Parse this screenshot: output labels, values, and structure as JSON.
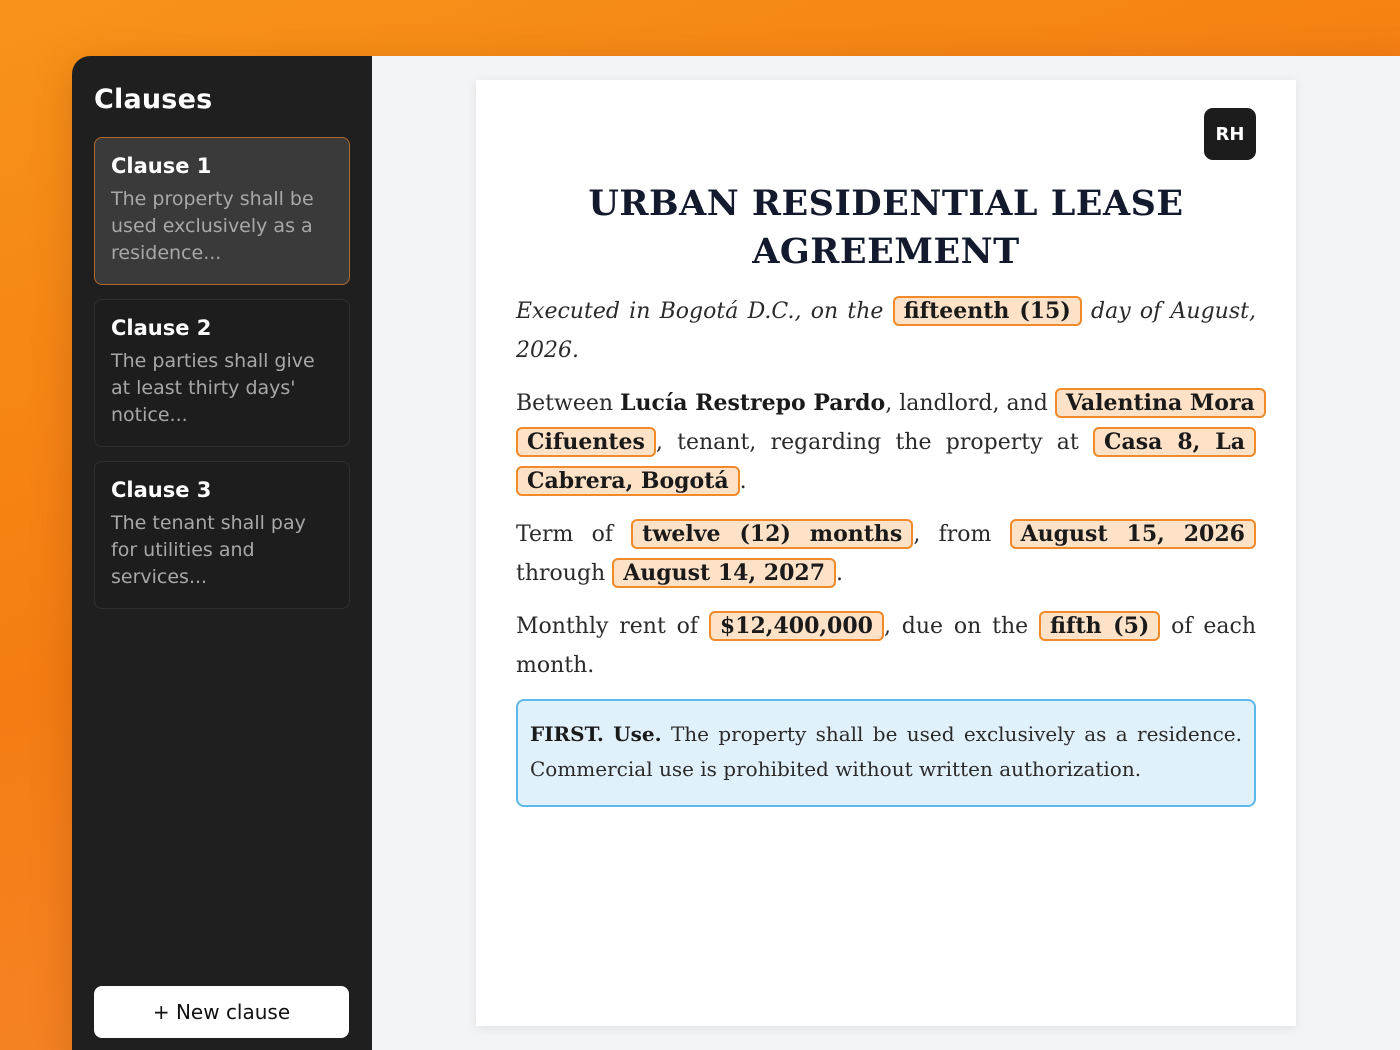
{
  "sidebar": {
    "title": "Clauses",
    "items": [
      {
        "label": "Clause 1",
        "preview": "The property shall be used exclusively as a residence...",
        "active": true
      },
      {
        "label": "Clause 2",
        "preview": "The parties shall give at least thirty days' notice...",
        "active": false
      },
      {
        "label": "Clause 3",
        "preview": "The tenant shall pay for utilities and services...",
        "active": false
      }
    ],
    "new_clause_label": "+ New clause"
  },
  "document": {
    "avatar_initials": "RH",
    "title": "URBAN RESIDENTIAL LEASE AGREEMENT",
    "executed": {
      "prefix": "Executed in Bogotá D.C., on the",
      "day": "fifteenth (15)",
      "suffix": "day of August, 2026."
    },
    "parties": {
      "between": "Between",
      "landlord_name": "Lucía Restrepo Pardo",
      "landlord_suffix": ", landlord, and",
      "tenant_name": "Valentina Mora Cifuentes",
      "tenant_suffix": ", tenant, regarding the property at",
      "property": "Casa 8, La Cabrera, Bogotá",
      "end": "."
    },
    "term": {
      "prefix": "Term of",
      "duration": "twelve (12) months",
      "from": ", from",
      "start": "August 15, 2026",
      "through": "through",
      "end_date": "August 14, 2027",
      "end": "."
    },
    "rent": {
      "prefix": "Monthly rent of",
      "amount": "$12,400,000",
      "due": ", due on the",
      "day": "fifth (5)",
      "suffix": "of each month."
    },
    "callout": {
      "heading": "FIRST.",
      "subheading": "Use.",
      "text": "The property shall be used exclusively as a residence. Commercial use is prohibited without written authorization."
    }
  },
  "colors": {
    "background_orange": "#f7931a",
    "sidebar_bg": "#1f1f1f",
    "highlight_fill": "#fde2c8",
    "highlight_border": "#f08a2a",
    "callout_fill": "#e1f1fc",
    "callout_border": "#5db8ea"
  }
}
